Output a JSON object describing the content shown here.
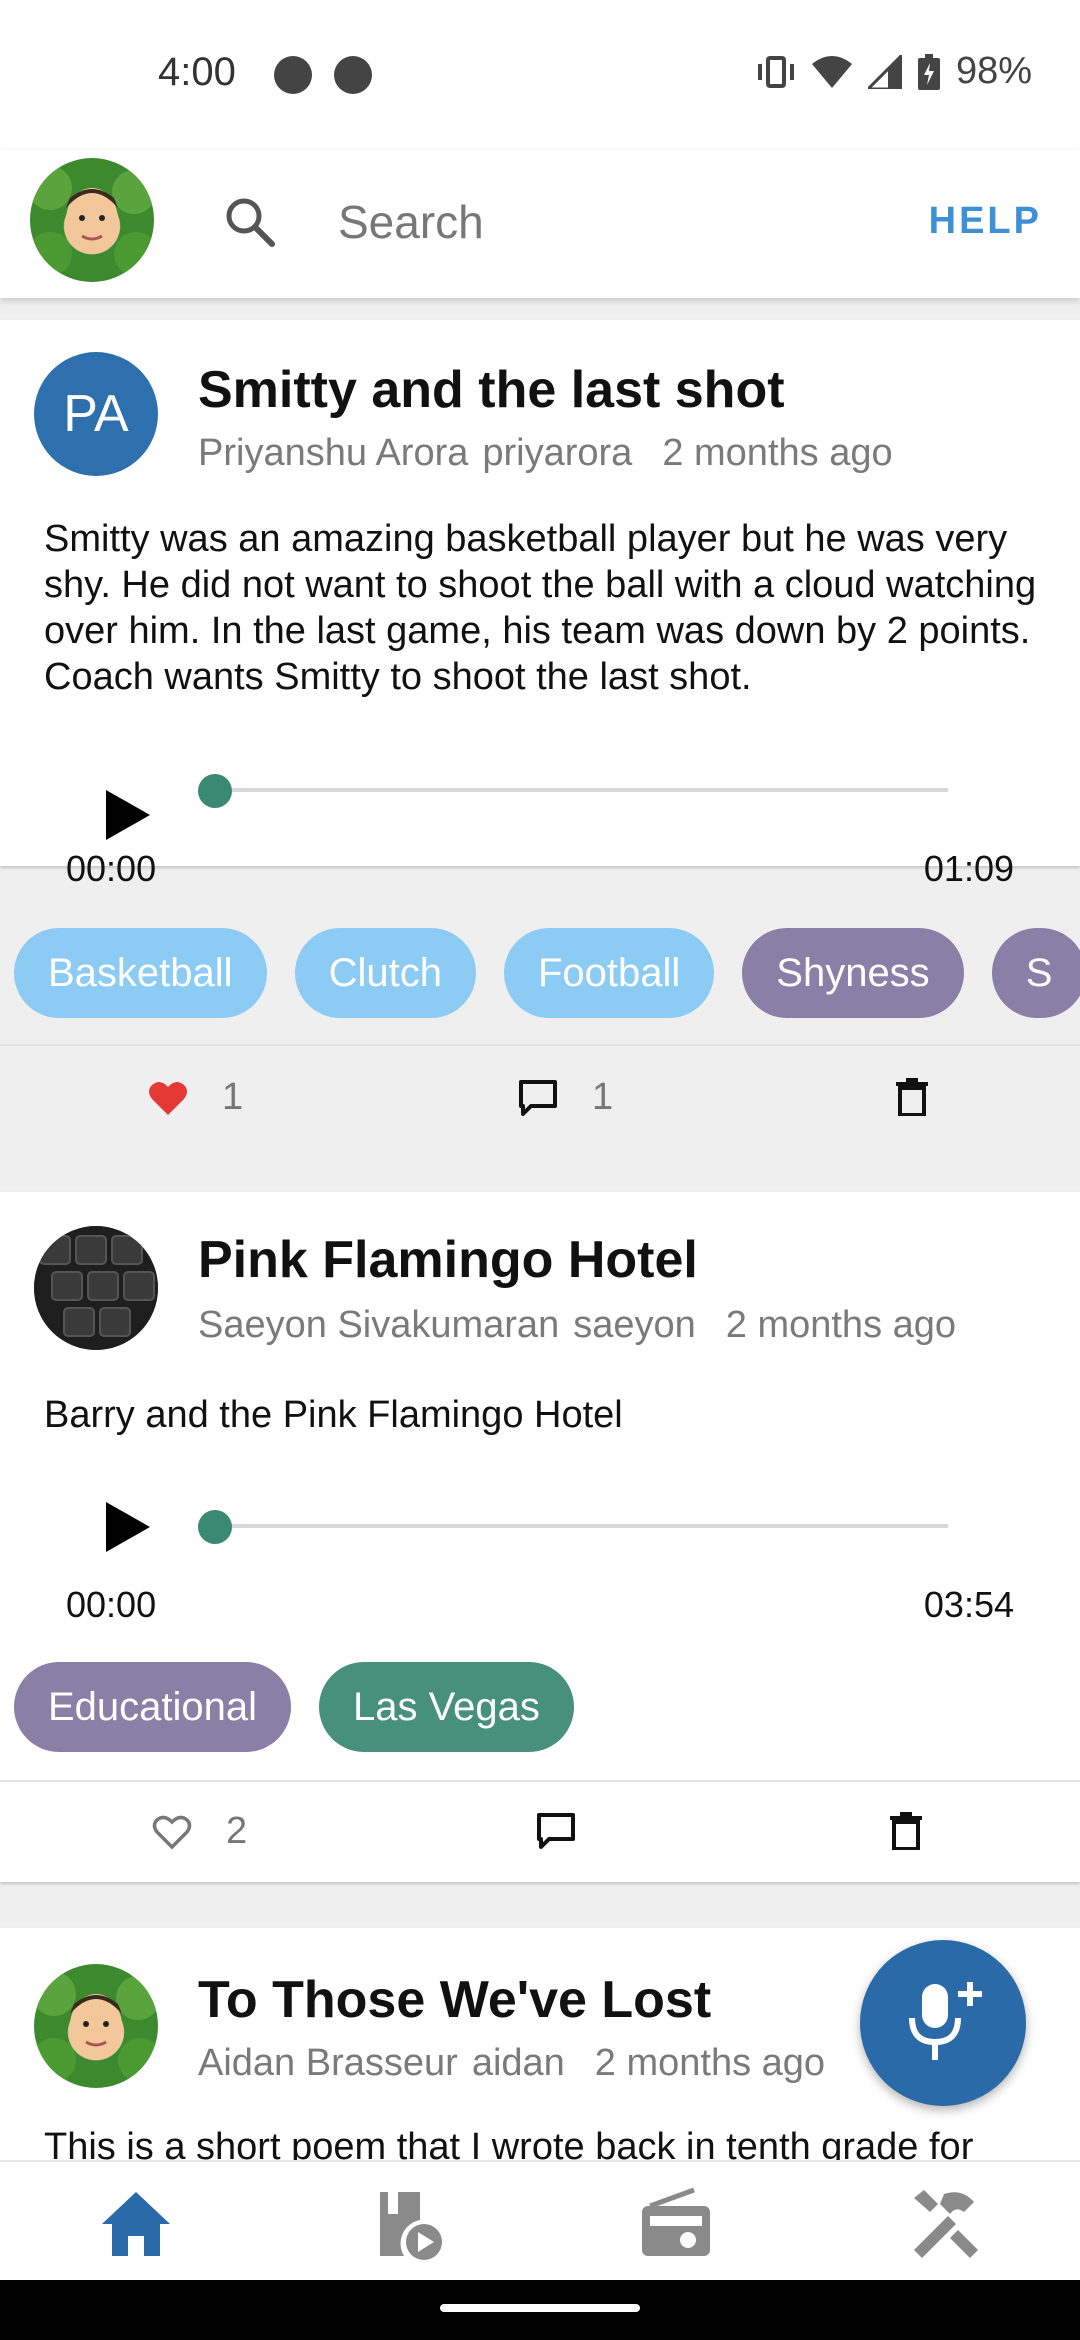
{
  "status_bar": {
    "time": "4:00",
    "battery": "98%"
  },
  "header": {
    "search_placeholder": "Search",
    "help_label": "HELP"
  },
  "colors": {
    "accent": "#3d8fd6",
    "primary": "#2b6aa8",
    "tag_blue": "#8ccbf4",
    "tag_purple": "#8a7fa6",
    "tag_green": "#479079",
    "like_red": "#e53935"
  },
  "posts": [
    {
      "initials": "PA",
      "title": "Smitty and the last shot",
      "author_name": "Priyanshu Arora",
      "username": "priyarora",
      "time_ago": "2 months ago",
      "description": "Smitty was an amazing basketball player but he was very shy. He did not want to shoot the ball with a cloud watching over him. In the last game, his team was down by 2 points. Coach wants Smitty to shoot the last shot.",
      "current_time": "00:00",
      "duration": "01:09",
      "tags": [
        "Basketball",
        "Clutch",
        "Football",
        "Shyness",
        "S"
      ],
      "likes": "1",
      "comments": "1",
      "liked": true
    },
    {
      "title": "Pink Flamingo Hotel",
      "author_name": "Saeyon Sivakumaran",
      "username": "saeyon",
      "time_ago": "2 months ago",
      "description": "Barry and the Pink Flamingo Hotel",
      "current_time": "00:00",
      "duration": "03:54",
      "tags": [
        "Educational",
        "Las Vegas"
      ],
      "likes": "2",
      "liked": false
    },
    {
      "title": "To Those We've Lost",
      "author_name": "Aidan Brasseur",
      "username": "aidan",
      "time_ago": "2 months ago",
      "description": "This is a short poem that I wrote back in tenth grade for"
    }
  ],
  "bottom_nav": [
    "home-icon",
    "library-icon",
    "radio-icon",
    "tools-icon"
  ],
  "fab": {
    "icon": "add-mic-icon"
  }
}
